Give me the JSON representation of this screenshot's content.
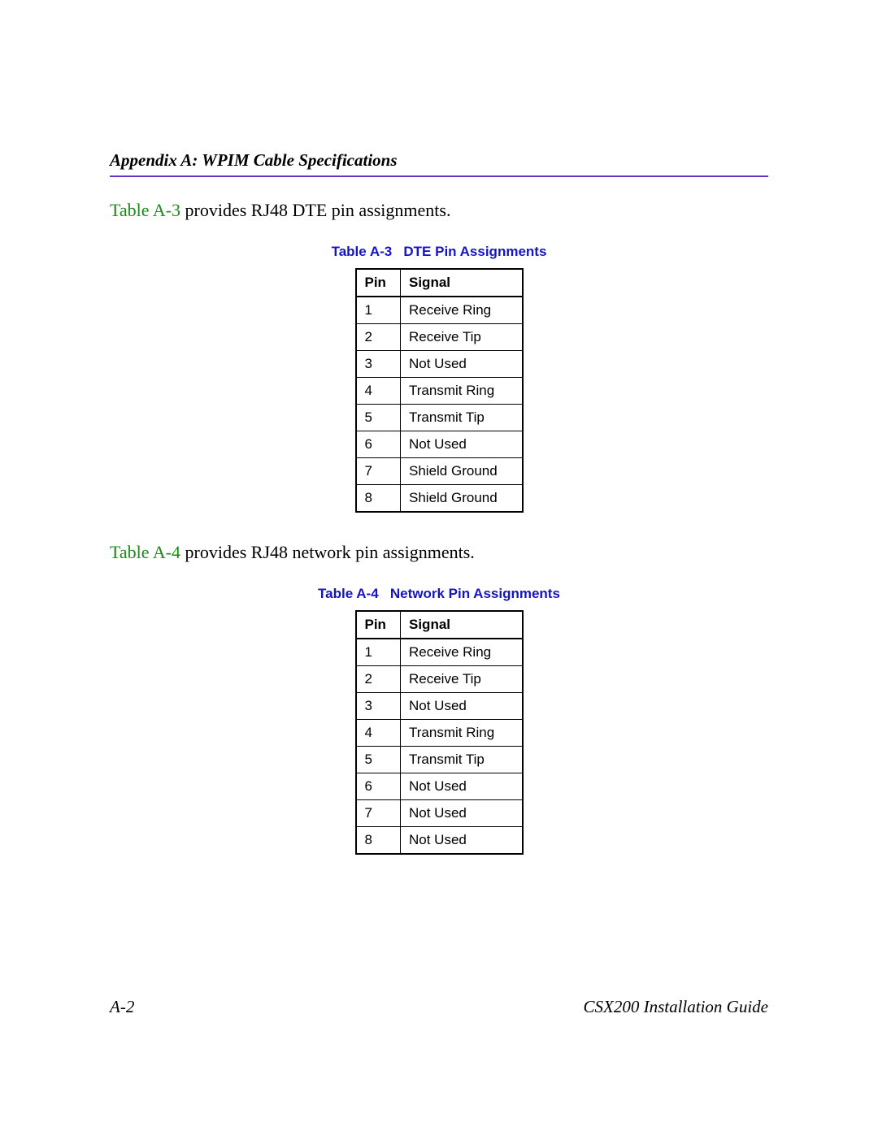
{
  "header": {
    "appendix_title": "Appendix A: WPIM Cable Specifications"
  },
  "body": {
    "para1_ref": "Table A-3",
    "para1_rest": " provides RJ48 DTE pin assignments.",
    "para2_ref": "Table A-4",
    "para2_rest": " provides RJ48 network pin assignments."
  },
  "tables": {
    "a3": {
      "caption_ref": "Table A-3",
      "caption_title": "DTE Pin Assignments",
      "col_pin": "Pin",
      "col_signal": "Signal",
      "rows": [
        {
          "pin": "1",
          "signal": "Receive Ring"
        },
        {
          "pin": "2",
          "signal": "Receive Tip"
        },
        {
          "pin": "3",
          "signal": "Not Used"
        },
        {
          "pin": "4",
          "signal": "Transmit Ring"
        },
        {
          "pin": "5",
          "signal": "Transmit Tip"
        },
        {
          "pin": "6",
          "signal": "Not Used"
        },
        {
          "pin": "7",
          "signal": "Shield Ground"
        },
        {
          "pin": "8",
          "signal": "Shield Ground"
        }
      ]
    },
    "a4": {
      "caption_ref": "Table A-4",
      "caption_title": "Network Pin Assignments",
      "col_pin": "Pin",
      "col_signal": "Signal",
      "rows": [
        {
          "pin": "1",
          "signal": "Receive Ring"
        },
        {
          "pin": "2",
          "signal": "Receive Tip"
        },
        {
          "pin": "3",
          "signal": "Not Used"
        },
        {
          "pin": "4",
          "signal": "Transmit Ring"
        },
        {
          "pin": "5",
          "signal": "Transmit Tip"
        },
        {
          "pin": "6",
          "signal": "Not Used"
        },
        {
          "pin": "7",
          "signal": "Not Used"
        },
        {
          "pin": "8",
          "signal": "Not Used"
        }
      ]
    }
  },
  "footer": {
    "page_number": "A-2",
    "doc_title": "CSX200 Installation Guide"
  }
}
